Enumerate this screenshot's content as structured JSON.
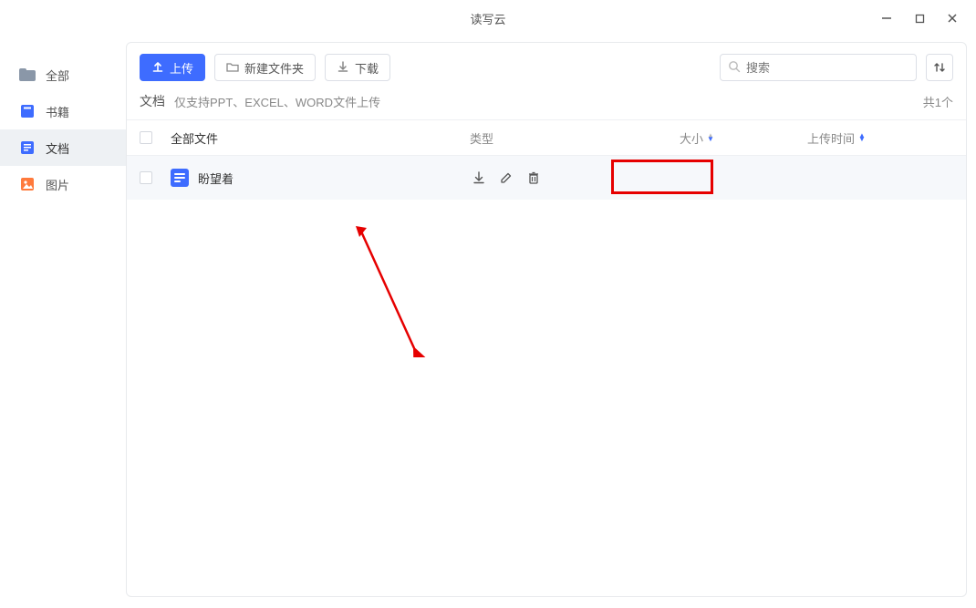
{
  "window": {
    "title": "读写云"
  },
  "sidebar": {
    "items": [
      {
        "label": "全部",
        "icon": "folder-all-icon",
        "color": "#7d8a9a"
      },
      {
        "label": "书籍",
        "icon": "book-icon",
        "color": "#3e6cff"
      },
      {
        "label": "文档",
        "icon": "doc-icon",
        "color": "#3e6cff"
      },
      {
        "label": "图片",
        "icon": "image-icon",
        "color": "#ff7a3c"
      }
    ]
  },
  "toolbar": {
    "upload_label": "上传",
    "new_folder_label": "新建文件夹",
    "download_label": "下载"
  },
  "search": {
    "placeholder": "搜索"
  },
  "hint": {
    "category_label": "文档",
    "tip_text": "仅支持PPT、EXCEL、WORD文件上传",
    "count_text": "共1个"
  },
  "table": {
    "headers": {
      "name": "全部文件",
      "type": "类型",
      "size": "大小",
      "time": "上传时间"
    },
    "rows": [
      {
        "name": "盼望着",
        "type": "",
        "size": "",
        "time": ""
      }
    ]
  }
}
